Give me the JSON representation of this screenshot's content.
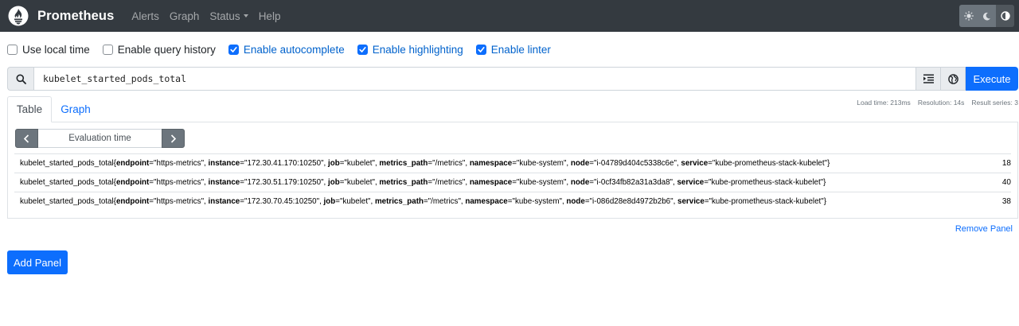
{
  "navbar": {
    "brand": "Prometheus",
    "links": {
      "alerts": "Alerts",
      "graph": "Graph",
      "status": "Status",
      "help": "Help"
    },
    "theme_icons": [
      "sun-icon",
      "moon-icon",
      "half-circle-icon"
    ]
  },
  "options": {
    "use_local_time": {
      "label": "Use local time",
      "checked": false
    },
    "enable_query_history": {
      "label": "Enable query history",
      "checked": false
    },
    "enable_autocomplete": {
      "label": "Enable autocomplete",
      "checked": true
    },
    "enable_highlighting": {
      "label": "Enable highlighting",
      "checked": true
    },
    "enable_linter": {
      "label": "Enable linter",
      "checked": true
    }
  },
  "query": {
    "expression": "kubelet_started_pods_total",
    "execute_label": "Execute"
  },
  "tabs": {
    "table": "Table",
    "graph": "Graph"
  },
  "stats": {
    "load_time": "Load time: 213ms",
    "resolution": "Resolution: 14s",
    "result_series": "Result series: 3"
  },
  "evaluation": {
    "placeholder": "Evaluation time"
  },
  "results": [
    {
      "metric": "kubelet_started_pods_total",
      "endpoint": "https-metrics",
      "instance": "172.30.41.170:10250",
      "job": "kubelet",
      "metrics_path": "/metrics",
      "namespace": "kube-system",
      "node": "i-04789d404c5338c6e",
      "service": "kube-prometheus-stack-kubelet",
      "value": "18"
    },
    {
      "metric": "kubelet_started_pods_total",
      "endpoint": "https-metrics",
      "instance": "172.30.51.179:10250",
      "job": "kubelet",
      "metrics_path": "/metrics",
      "namespace": "kube-system",
      "node": "i-0cf34fb82a31a3da8",
      "service": "kube-prometheus-stack-kubelet",
      "value": "40"
    },
    {
      "metric": "kubelet_started_pods_total",
      "endpoint": "https-metrics",
      "instance": "172.30.70.45:10250",
      "job": "kubelet",
      "metrics_path": "/metrics",
      "namespace": "kube-system",
      "node": "i-086d28e8d4972b2b6",
      "service": "kube-prometheus-stack-kubelet",
      "value": "38"
    }
  ],
  "remove_panel": "Remove Panel",
  "add_panel": "Add Panel",
  "colors": {
    "navbar": "#343a40",
    "primary": "#0d6efd",
    "secondary": "#6c757d"
  }
}
